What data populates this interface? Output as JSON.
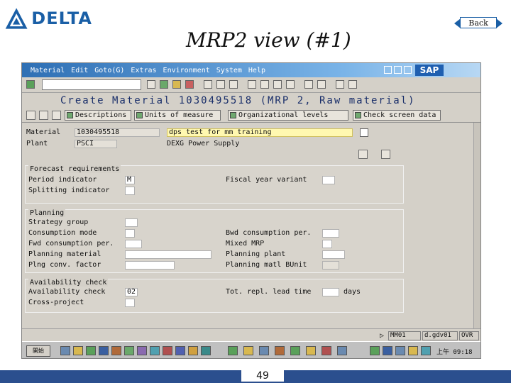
{
  "slide": {
    "logo_text": "DELTA",
    "title": "MRP2 view (#1)",
    "back_label": "Back",
    "page_number": "49"
  },
  "sap": {
    "menu": [
      "Material",
      "Edit",
      "Goto(G)",
      "Extras",
      "Environment",
      "System",
      "Help"
    ],
    "logo_text": "SAP",
    "screen_title": "Create Material 1030495518 (MRP 2, Raw material)",
    "app_toolbar": {
      "descriptions": "Descriptions",
      "units_of_measure": "Units of measure",
      "org_levels": "Organizational levels",
      "check_screen_data": "Check screen data"
    },
    "header": {
      "material_label": "Material",
      "material_value": "1030495518",
      "material_desc": "dps test for mm training",
      "plant_label": "Plant",
      "plant_value": "PSCI",
      "plant_desc": "DEXG Power Supply"
    },
    "forecast": {
      "title": "Forecast requirements",
      "period_indicator_label": "Period indicator",
      "period_indicator_value": "M",
      "splitting_label": "Splitting indicator",
      "fiscal_year_label": "Fiscal year variant"
    },
    "planning": {
      "title": "Planning",
      "strategy_group": "Strategy group",
      "consumption_mode": "Consumption mode",
      "fwd_consumption": "Fwd consumption per.",
      "planning_material": "Planning material",
      "plng_conv_factor": "Plng conv. factor",
      "bwd_consumption": "Bwd consumption per.",
      "mixed_mrp": "Mixed MRP",
      "planning_plant": "Planning plant",
      "planning_matl_buint": "Planning matl BUnit"
    },
    "availability": {
      "title": "Availability check",
      "availability_check_label": "Availability check",
      "availability_check_value": "02",
      "cross_project_label": "Cross-project",
      "tot_repl_label": "Tot. repl. lead time",
      "days_label": "days"
    },
    "status": {
      "system": "MM01",
      "server": "d.gdv01",
      "mode": "OVR"
    },
    "taskbar": {
      "start_label": "開始",
      "clock": "上午 09:18"
    }
  }
}
